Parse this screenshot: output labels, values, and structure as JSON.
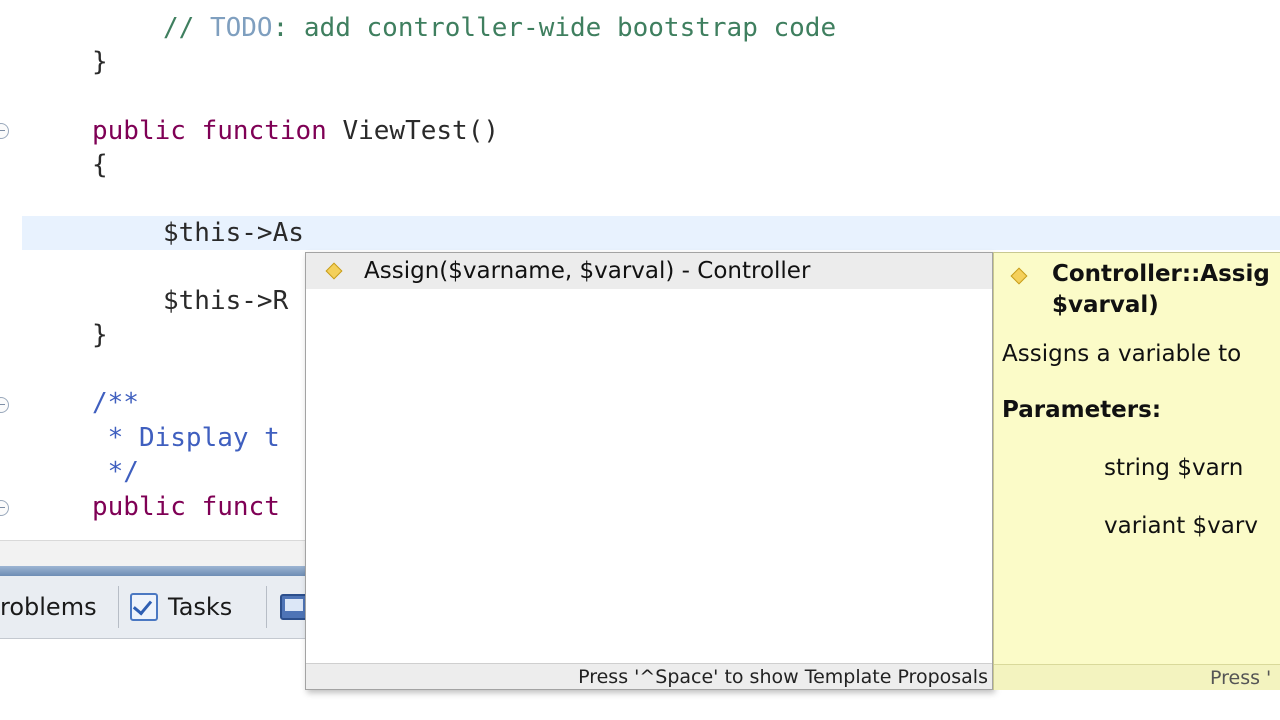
{
  "editor": {
    "lines": {
      "todo_prefix": "// ",
      "todo_word": "TODO",
      "todo_rest": ": add controller-wide bootstrap code",
      "close_brace_1": "}",
      "kw_public": "public",
      "kw_function": "function",
      "method_name": " ViewTest()",
      "open_brace": "{",
      "current_line": "$this->As",
      "next_line": "$this->R",
      "close_brace_2": "}",
      "doc_open": "/**",
      "doc_text": " * Display t",
      "doc_close": " */",
      "kw_public_2": "public",
      "kw_funct_partial": "funct"
    }
  },
  "views": {
    "tabs": [
      {
        "label": "roblems"
      },
      {
        "label": "Tasks",
        "icon": "tasks-icon"
      }
    ]
  },
  "content_assist": {
    "proposals": [
      {
        "label": "Assign($varname, $varval) - Controller",
        "icon": "method-diamond-icon"
      }
    ],
    "status": "Press '^Space' to show Template Proposals"
  },
  "doc_popup": {
    "title_line1": "Controller::Assig",
    "title_line2": "$varval)",
    "description": "Assigns a variable to",
    "params_heading": "Parameters:",
    "params": [
      "string $varn",
      "variant $varv"
    ],
    "status": "Press '"
  },
  "colors": {
    "keyword": "#7f0055",
    "comment": "#3f7f5f",
    "javadoc": "#3f5fbf",
    "current_line_highlight": "#e8f2fe",
    "hover_background": "#fbfbc8"
  }
}
